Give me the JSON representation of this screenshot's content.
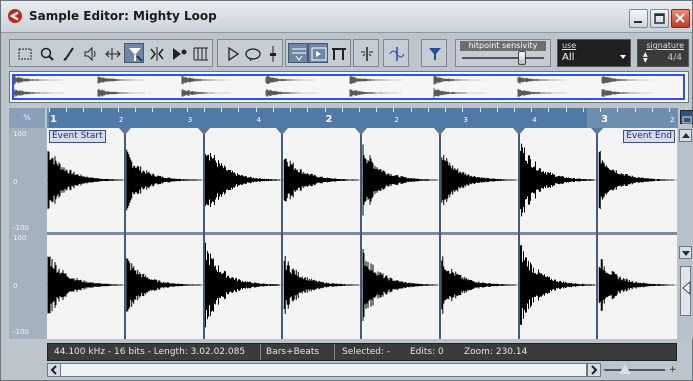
{
  "window": {
    "title": "Sample Editor: Mighty Loop",
    "app_icon": "cubase-logo-icon",
    "controls": [
      "minimize-icon",
      "maximize-icon",
      "close-icon"
    ]
  },
  "toolbar": {
    "tools": [
      {
        "name": "range-select-tool",
        "icon": "range-select-icon",
        "active": false
      },
      {
        "name": "zoom-tool",
        "icon": "magnifier-icon",
        "active": false
      },
      {
        "name": "draw-tool",
        "icon": "pencil-icon",
        "active": false
      },
      {
        "name": "audition-tool",
        "icon": "speaker-icon",
        "active": false
      },
      {
        "name": "scrub-tool",
        "icon": "scrub-icon",
        "active": false
      },
      {
        "name": "hitpoint-edit-tool",
        "icon": "hitpoint-edit-icon",
        "active": true
      },
      {
        "name": "warp-tool",
        "icon": "warp-icon",
        "active": false
      },
      {
        "name": "audio-slice-tool",
        "icon": "slice-icon",
        "active": false
      },
      {
        "name": "grid-tool",
        "icon": "grid-icon",
        "active": false
      }
    ],
    "transport": [
      {
        "name": "play-button",
        "icon": "play-icon",
        "active": false
      },
      {
        "name": "loop-button",
        "icon": "loop-icon",
        "active": false
      },
      {
        "name": "level-button",
        "icon": "level-icon",
        "active": false
      }
    ],
    "view": [
      {
        "name": "show-hitpoints-button",
        "icon": "hitpoints-view-icon",
        "active": true
      },
      {
        "name": "show-slices-button",
        "icon": "slices-view-icon",
        "active": true
      },
      {
        "name": "show-grid-button",
        "icon": "grid-view-icon",
        "active": false
      }
    ],
    "misc": [
      {
        "name": "snap-button",
        "icon": "snap-icon",
        "active": false
      },
      {
        "name": "zero-crossing-button",
        "icon": "zero-crossing-icon",
        "active": false
      },
      {
        "name": "hitpoint-filter-button",
        "icon": "funnel-icon",
        "active": false
      }
    ],
    "sensitivity": {
      "label": "hitpoint sensivity",
      "value": 0.75
    },
    "use": {
      "label": "use",
      "value": "All"
    },
    "signature": {
      "label": "signature",
      "value": "4/4"
    }
  },
  "ruler": {
    "mode_label": "%",
    "bars": [
      "1",
      "2",
      "3",
      "4",
      "2",
      "2",
      "3",
      "4",
      "3",
      "2"
    ]
  },
  "editor": {
    "scale_labels": [
      "100",
      "0",
      "-100",
      "100",
      "0",
      "-100"
    ],
    "event_start_label": "Event Start",
    "event_end_label": "Event End",
    "hitpoint_count": 8
  },
  "status": {
    "format": "44.100 kHz - 16 bits - Length: 3.02.02.085",
    "time_format": "Bars+Beats",
    "selected": "Selected: -",
    "edits": "Edits: 0",
    "zoom": "Zoom: 230.14"
  },
  "hscroll": {
    "minus": "-",
    "plus": "+"
  },
  "colors": {
    "window_bg": "#bcc4cc",
    "ruler_bg": "#6e8eb0",
    "waveform": "#000000",
    "hitpoint_line": "#475a78",
    "overview_frame": "#2c50ff"
  }
}
